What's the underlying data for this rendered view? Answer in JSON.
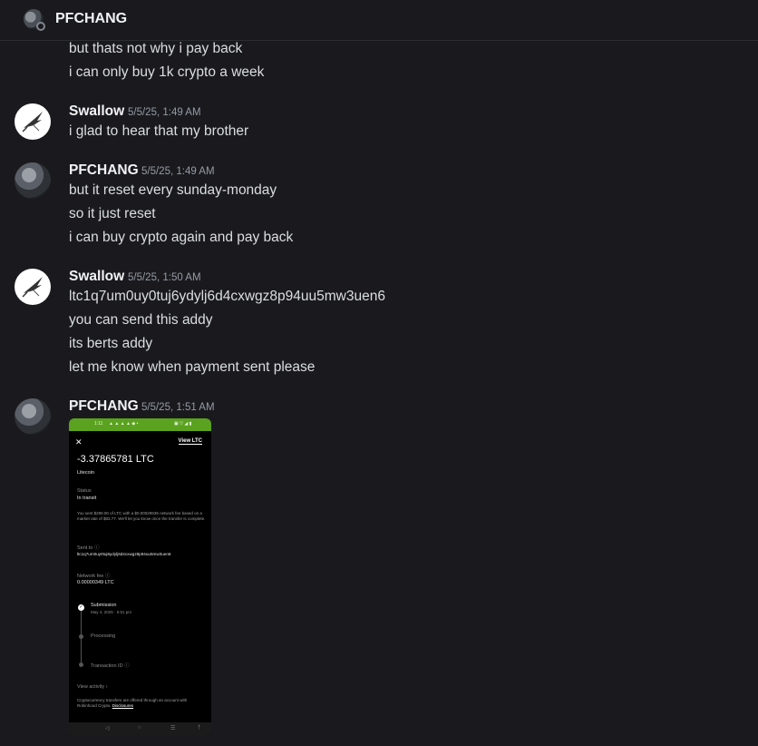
{
  "header": {
    "title": "PFCHANG"
  },
  "messages": [
    {
      "lines": [
        "but thats not why i pay back",
        "i can only buy 1k crypto a week"
      ]
    },
    {
      "author": "Swallow",
      "timestamp": "5/5/25, 1:49 AM",
      "lines": [
        "i glad to hear that my brother"
      ]
    },
    {
      "author": "PFCHANG",
      "timestamp": "5/5/25, 1:49 AM",
      "lines": [
        "but it reset every sunday-monday",
        "so it just reset",
        "i can buy crypto again and pay back"
      ]
    },
    {
      "author": "Swallow",
      "timestamp": "5/5/25, 1:50 AM",
      "lines": [
        "ltc1q7um0uy0tuj6ydylj6d4cxwgz8p94uu5mw3uen6",
        "you can send this addy",
        "its berts addy",
        "let me know when payment sent please"
      ]
    },
    {
      "author": "PFCHANG",
      "timestamp": "5/5/25, 1:51 AM",
      "lines": []
    }
  ],
  "attachment": {
    "status_time": "1:11",
    "view_link": "View LTC",
    "amount": "-3.37865781 LTC",
    "asset": "Litecoin",
    "status_label": "Status",
    "status_value": "In transit",
    "description": "You sent $299.00 of LTC with a $0.00029935 network fee based on a market rate of $83.77. We'll let you know once the transfer is complete.",
    "sent_to_label": "Sent to",
    "sent_to_value": "ltc1q7um0uy0tuj6ydylj6d4cxwgz8p94uu5mw3uen6",
    "fee_label": "Network fee",
    "fee_value": "0.00000349 LTC",
    "steps": [
      {
        "label": "Submission",
        "sub": "May 4, 2025 · 5:51 pm"
      },
      {
        "label": "Processing",
        "sub": ""
      },
      {
        "label": "Transaction ID",
        "sub": ""
      }
    ],
    "activity_link": "View activity",
    "footer": "Cryptocurrency transfers are offered through an account with Robinhood Crypto.",
    "footer_link": "Disclosures"
  },
  "colors": {
    "background": "#1a1a1e",
    "username": "#f2f3f5",
    "text": "#dbdee1",
    "timestamp": "#949ba4",
    "status_bar": "#5aa21f"
  }
}
